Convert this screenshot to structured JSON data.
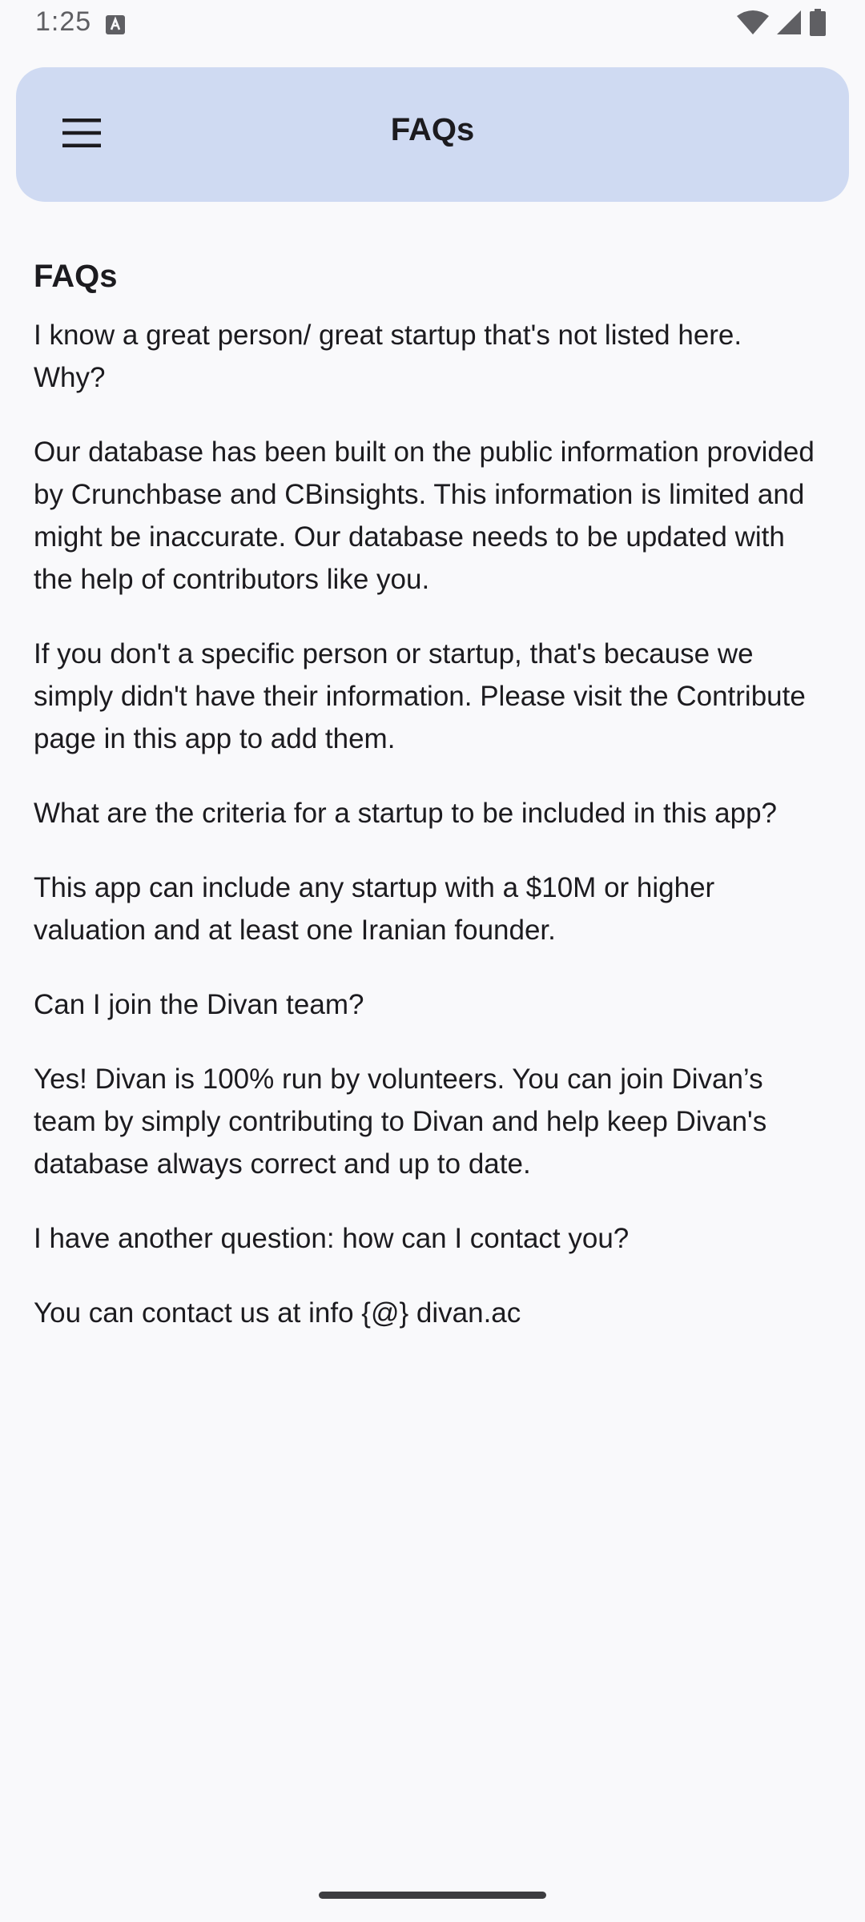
{
  "status_bar": {
    "time": "1:25",
    "icons": [
      "notification-a-icon",
      "wifi-icon",
      "cellular-signal-icon",
      "battery-icon"
    ]
  },
  "app_bar": {
    "menu_icon": "hamburger-menu-icon",
    "title": "FAQs"
  },
  "content": {
    "heading": "FAQs",
    "paragraphs": [
      "I know a great person/ great startup that's not listed here. Why?",
      "Our database has been built on the public information provided by Crunchbase and CBinsights. This information is limited and might be inaccurate. Our database needs to be updated with the help of contributors like you.",
      "If you don't a specific person or startup, that's because we simply didn't have their information. Please visit the Contribute page in this app to add them.",
      "What are the criteria for a startup to be included in this app?",
      "This app can include any startup with a $10M or higher valuation and at least one Iranian founder.",
      "Can I join the Divan team?",
      "Yes! Divan is 100% run by volunteers. You can join Divan’s team by simply contributing to Divan and help keep Divan's database always correct and up to date.",
      "I have another question: how can I contact you?",
      "You can contact us at info {@} divan.ac"
    ]
  },
  "colors": {
    "background": "#f9f9fb",
    "app_bar": "#cfdaf2",
    "text": "#1c1b1f"
  }
}
